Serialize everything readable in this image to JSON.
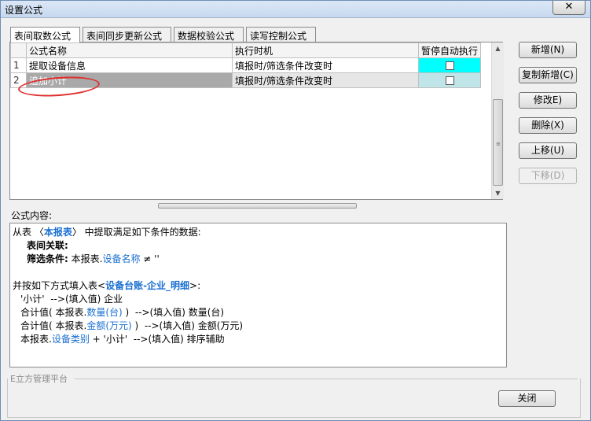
{
  "window": {
    "title": "设置公式",
    "close_symbol": "✕"
  },
  "tabs": [
    {
      "label": "表间取数公式",
      "active": true
    },
    {
      "label": "表间同步更新公式",
      "active": false
    },
    {
      "label": "数据校验公式",
      "active": false
    },
    {
      "label": "读写控制公式",
      "active": false
    }
  ],
  "grid": {
    "columns": [
      "公式名称",
      "执行时机",
      "暂停自动执行"
    ],
    "rows": [
      {
        "num": "1",
        "name": "提取设备信息",
        "time": "填报时/筛选条件改变时",
        "paused": false
      },
      {
        "num": "2",
        "name": "追加小计",
        "time": "填报时/筛选条件改变时",
        "paused": false,
        "selected": true
      }
    ]
  },
  "buttons": {
    "add": "新增(N)",
    "copy_add": "复制新增(C)",
    "edit": "修改E)",
    "delete": "删除(X)",
    "move_up": "上移(U)",
    "move_down": "下移(D)",
    "close": "关闭"
  },
  "content": {
    "label": "公式内容:",
    "l1_a": "从表 〈",
    "l1_b": "本报表",
    "l1_c": "〉 中提取满足如下条件的数据:",
    "l2": "表间关联:",
    "l3_a": "筛选条件:",
    "l3_b": " 本报表.",
    "l3_c": "设备名称",
    "l3_d": " ≠ ''",
    "l5_a": "并按如下方式填入表<",
    "l5_b": "设备台账-企业_明细",
    "l5_c": ">:",
    "l6": "'小计'  -->(填入值) 企业",
    "l7_a": "合计值( 本报表.",
    "l7_b": "数量(台)",
    "l7_c": " )  -->(填入值) 数量(台)",
    "l8_a": "合计值( 本报表.",
    "l8_b": "金额(万元)",
    "l8_c": " )  -->(填入值) 金额(万元)",
    "l9_a": "本报表.",
    "l9_b": "设备类别",
    "l9_c": " + '小计'  -->(填入值) 排序辅助"
  },
  "footer": {
    "platform": "E立方管理平台"
  },
  "colors": {
    "accent_cyan": "#00ffff",
    "link_blue": "#1a6fd1",
    "annotation_red": "#e03030"
  }
}
